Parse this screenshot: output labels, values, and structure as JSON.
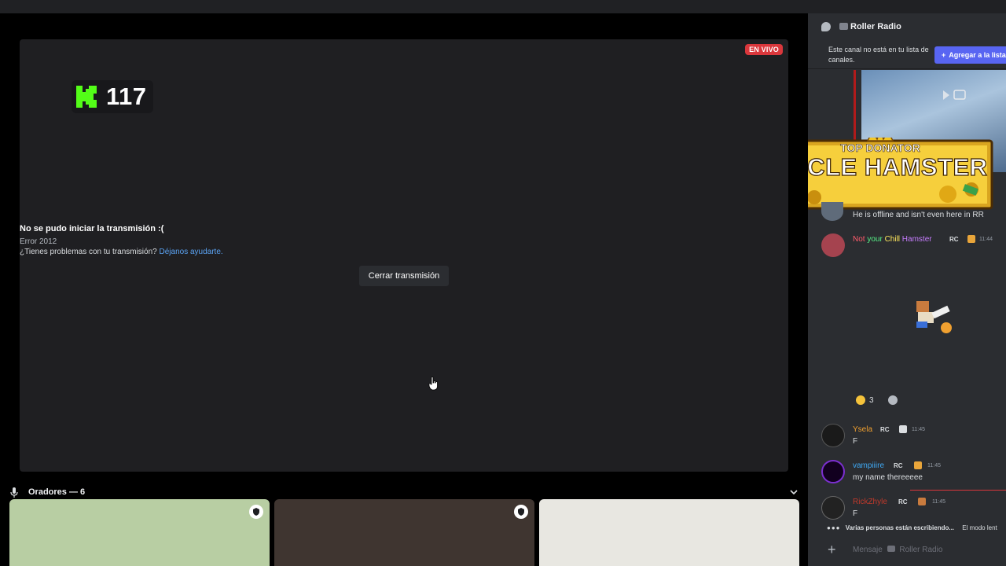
{
  "stream": {
    "live_badge": "EN VIVO",
    "viewer_count": "117",
    "error_title": "No se pudo iniciar la transmisión :(",
    "error_code": "Error 2012",
    "help_question": "¿Tienes problemas con tu transmisión?",
    "help_link": "Déjanos ayudarte.",
    "close_button": "Cerrar transmisión"
  },
  "speakers": {
    "label": "Oradores — 6"
  },
  "chat": {
    "channel_name": "Roller Radio",
    "notice": "Este canal no está en tu lista de canales.",
    "add_button": "Agregar a la lista",
    "banner_top": "TOP DONATOR",
    "banner_name": "UNCLE HAMSTER",
    "messages": [
      {
        "text": "He is offline and isn't even here in RR"
      },
      {
        "user_part1": "Not",
        "user_part2": " your ",
        "user_part3": "Chill",
        "user_part4": " Hamster",
        "tag": "RC",
        "time": "11:44"
      },
      {
        "user": "Ysela",
        "tag": "RC",
        "time": "11:45",
        "text": "F"
      },
      {
        "user": "vampiiire",
        "tag": "RC",
        "time": "11:45",
        "text": "my name thereeeee"
      },
      {
        "user": "RickZhyle",
        "tag": "RC",
        "time": "11:45",
        "text": "F"
      }
    ],
    "reaction_count": "3",
    "typing_text": "Varias personas están escribiendo...",
    "slow_mode": "El modo lent",
    "input_placeholder": "Mensaje",
    "input_channel": "Roller Radio"
  },
  "colors": {
    "accent": "#5865f2",
    "live": "#da373c",
    "kick_green": "#53fc18",
    "link": "#5ba4f5"
  }
}
